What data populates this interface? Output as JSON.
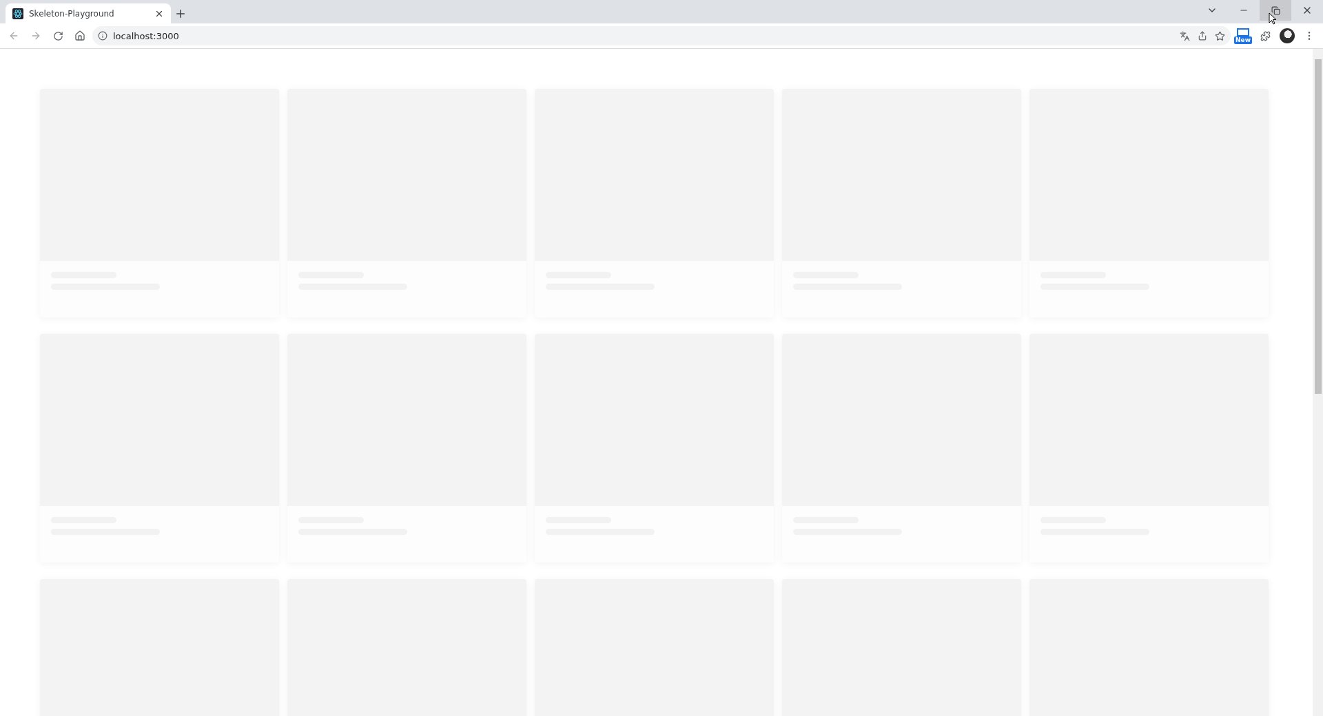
{
  "browser": {
    "tabs": [
      {
        "title": "Skeleton-Playground",
        "selected": true
      }
    ],
    "address": "localhost:3000",
    "extension_badge": "New"
  },
  "cards": [
    {
      "kind": "skeleton"
    },
    {
      "kind": "skeleton"
    },
    {
      "kind": "skeleton"
    },
    {
      "kind": "skeleton"
    },
    {
      "kind": "skeleton"
    },
    {
      "kind": "skeleton"
    },
    {
      "kind": "skeleton"
    },
    {
      "kind": "skeleton"
    },
    {
      "kind": "skeleton"
    },
    {
      "kind": "skeleton"
    },
    {
      "kind": "cut"
    },
    {
      "kind": "cut"
    },
    {
      "kind": "cut"
    },
    {
      "kind": "cut"
    },
    {
      "kind": "cut"
    }
  ]
}
